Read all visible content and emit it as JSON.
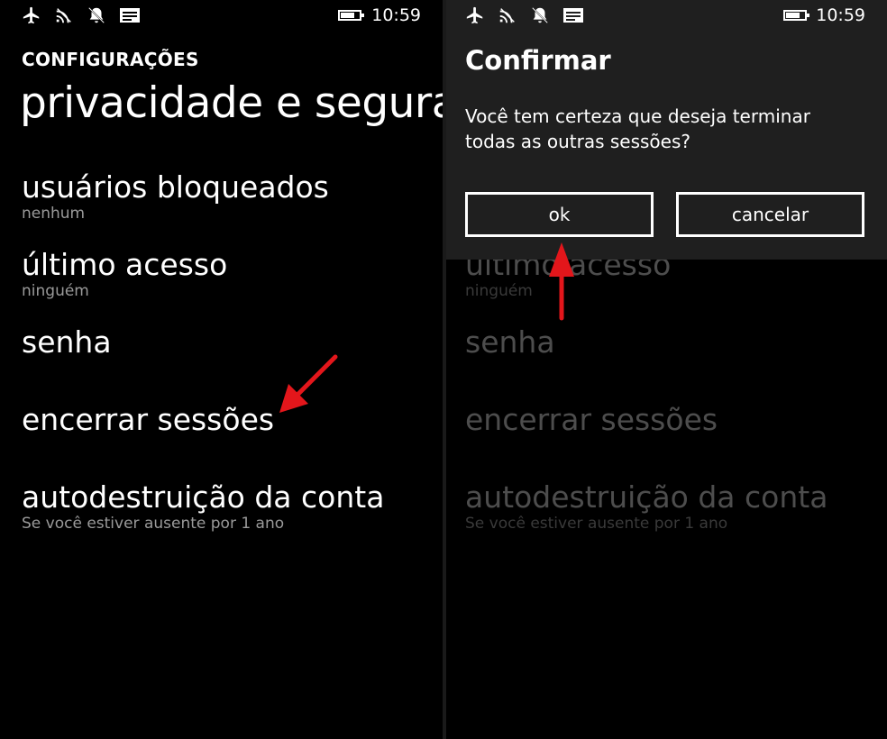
{
  "status_bar": {
    "icons": [
      "airplane-icon",
      "wifi-icon",
      "quiet-hours-icon",
      "message-icon"
    ],
    "battery_level": 0.75,
    "time": "10:59"
  },
  "left_screen": {
    "section_title": "CONFIGURAÇÕES",
    "page_title": "privacidade e segurança",
    "items": [
      {
        "label": "usuários bloqueados",
        "sub": "nenhum"
      },
      {
        "label": "último acesso",
        "sub": "ninguém"
      },
      {
        "label": "senha",
        "sub": ""
      },
      {
        "label": "encerrar sessões",
        "sub": ""
      },
      {
        "label": "autodestruição da conta",
        "sub": "Se você estiver ausente por 1 ano"
      }
    ]
  },
  "dialog": {
    "title": "Confirmar",
    "message": "Você tem certeza que deseja terminar todas as outras sessões?",
    "ok_label": "ok",
    "cancel_label": "cancelar"
  },
  "annotation": {
    "arrow_color": "#e3161b"
  }
}
